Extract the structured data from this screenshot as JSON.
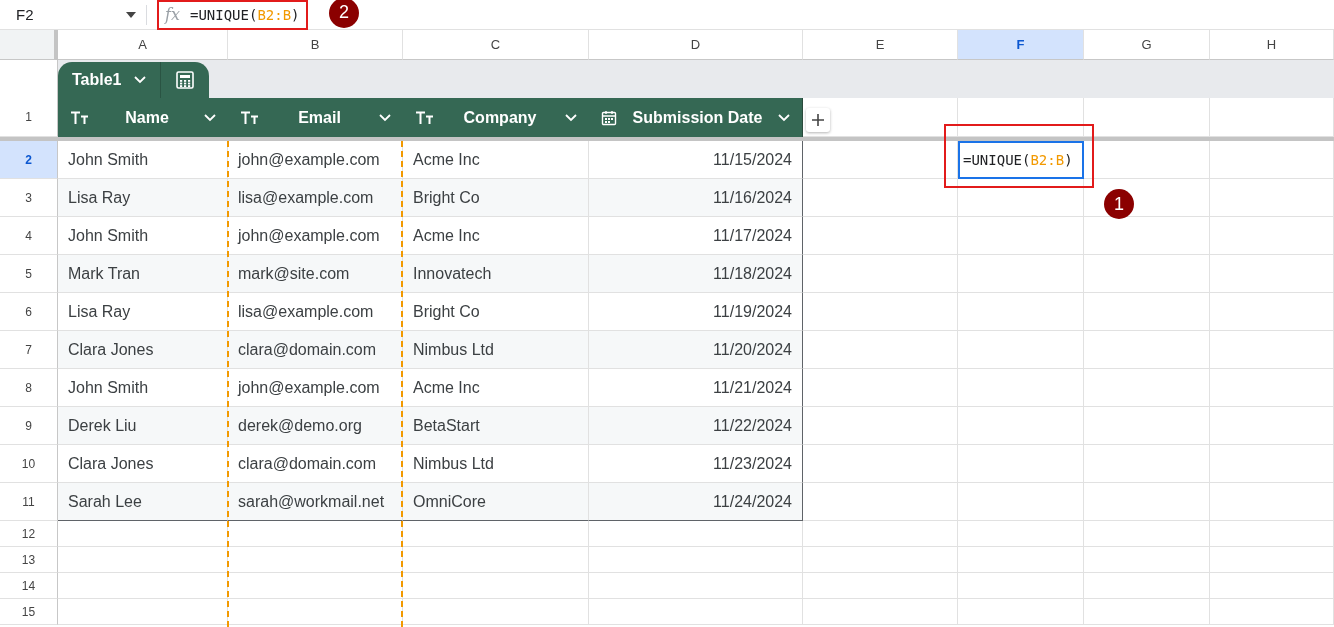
{
  "name_box": "F2",
  "formula_bar": {
    "icon_label": "fx",
    "formula": {
      "prefix": "=UNIQUE(",
      "range": "B2:B",
      "suffix": ")"
    },
    "callout": "2"
  },
  "columns": [
    {
      "label": "A",
      "selected": false
    },
    {
      "label": "B",
      "selected": false
    },
    {
      "label": "C",
      "selected": false
    },
    {
      "label": "D",
      "selected": false
    },
    {
      "label": "E",
      "selected": false
    },
    {
      "label": "F",
      "selected": true
    },
    {
      "label": "G",
      "selected": false
    },
    {
      "label": "H",
      "selected": false
    }
  ],
  "row_numbers": [
    {
      "label": "1",
      "selected": false
    },
    {
      "label": "2",
      "selected": true
    },
    {
      "label": "3",
      "selected": false
    },
    {
      "label": "4",
      "selected": false
    },
    {
      "label": "5",
      "selected": false
    },
    {
      "label": "6",
      "selected": false
    },
    {
      "label": "7",
      "selected": false
    },
    {
      "label": "8",
      "selected": false
    },
    {
      "label": "9",
      "selected": false
    },
    {
      "label": "10",
      "selected": false
    },
    {
      "label": "11",
      "selected": false
    },
    {
      "label": "12",
      "selected": false
    },
    {
      "label": "13",
      "selected": false
    },
    {
      "label": "14",
      "selected": false
    },
    {
      "label": "15",
      "selected": false
    }
  ],
  "table": {
    "name": "Table1",
    "columns": [
      {
        "label": "Name",
        "kind": "text"
      },
      {
        "label": "Email",
        "kind": "text"
      },
      {
        "label": "Company",
        "kind": "text"
      },
      {
        "label": "Submission Date",
        "kind": "date"
      }
    ],
    "rows": [
      [
        "John Smith",
        "john@example.com",
        "Acme Inc",
        "11/15/2024"
      ],
      [
        "Lisa Ray",
        "lisa@example.com",
        "Bright Co",
        "11/16/2024"
      ],
      [
        "John Smith",
        "john@example.com",
        "Acme Inc",
        "11/17/2024"
      ],
      [
        "Mark Tran",
        "mark@site.com",
        "Innovatech",
        "11/18/2024"
      ],
      [
        "Lisa Ray",
        "lisa@example.com",
        "Bright Co",
        "11/19/2024"
      ],
      [
        "Clara Jones",
        "clara@domain.com",
        "Nimbus Ltd",
        "11/20/2024"
      ],
      [
        "John Smith",
        "john@example.com",
        "Acme Inc",
        "11/21/2024"
      ],
      [
        "Derek Liu",
        "derek@demo.org",
        "BetaStart",
        "11/22/2024"
      ],
      [
        "Clara Jones",
        "clara@domain.com",
        "Nimbus Ltd",
        "11/23/2024"
      ],
      [
        "Sarah Lee",
        "sarah@workmail.net",
        "OmniCore",
        "11/24/2024"
      ]
    ]
  },
  "cell_editor": {
    "formula": {
      "prefix": "=UNIQUE(",
      "range": "B2:B",
      "suffix": ")"
    },
    "callout": "1"
  }
}
